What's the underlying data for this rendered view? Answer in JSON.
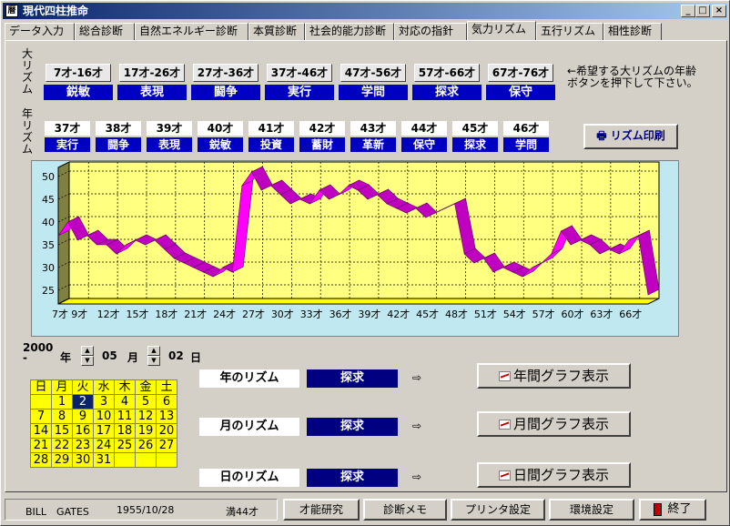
{
  "window": {
    "title": "現代四柱推命",
    "icon": "app-icon",
    "min_glyph": "_",
    "max_glyph": "□",
    "close_glyph": "×"
  },
  "tabs": [
    {
      "label": "データ入力"
    },
    {
      "label": "総合診断"
    },
    {
      "label": "自然エネルギー診断"
    },
    {
      "label": "本質診断"
    },
    {
      "label": "社会的能力診断"
    },
    {
      "label": "対応の指針"
    },
    {
      "label": "気力リズム"
    },
    {
      "label": "五行リズム"
    },
    {
      "label": "相性診断"
    }
  ],
  "active_tab": 6,
  "decade": {
    "side_label": "大リズム",
    "items": [
      {
        "age": "7才-16才",
        "label": "鋭敏"
      },
      {
        "age": "17才-26才",
        "label": "表現"
      },
      {
        "age": "27才-36才",
        "label": "闘争"
      },
      {
        "age": "37才-46才",
        "label": "実行"
      },
      {
        "age": "47才-56才",
        "label": "学問"
      },
      {
        "age": "57才-66才",
        "label": "探求"
      },
      {
        "age": "67才-76才",
        "label": "保守"
      }
    ],
    "note": "←希望する大リズムの年齢ボタンを押下して下さい。"
  },
  "yearly": {
    "side_label": "年リズム",
    "items": [
      {
        "age": "37才",
        "label": "実行"
      },
      {
        "age": "38才",
        "label": "闘争"
      },
      {
        "age": "39才",
        "label": "表現"
      },
      {
        "age": "40才",
        "label": "鋭敏"
      },
      {
        "age": "41才",
        "label": "投資"
      },
      {
        "age": "42才",
        "label": "蓄財"
      },
      {
        "age": "43才",
        "label": "革新"
      },
      {
        "age": "44才",
        "label": "保守"
      },
      {
        "age": "45才",
        "label": "探求"
      },
      {
        "age": "46才",
        "label": "学問"
      }
    ]
  },
  "print_button": {
    "label": "リズム印刷",
    "icon": "printer-icon"
  },
  "chart_data": {
    "type": "area",
    "style": "3d-ribbon",
    "x_tick_labels": [
      "7才",
      "9才",
      "12才",
      "15才",
      "18才",
      "21才",
      "24才",
      "27才",
      "30才",
      "33才",
      "36才",
      "39才",
      "42才",
      "45才",
      "48才",
      "51才",
      "54才",
      "57才",
      "60才",
      "63才",
      "66才"
    ],
    "x": [
      7,
      8,
      9,
      10,
      11,
      12,
      13,
      14,
      15,
      16,
      17,
      18,
      19,
      20,
      21,
      22,
      23,
      24,
      25,
      26,
      27,
      28,
      29,
      30,
      31,
      32,
      33,
      34,
      35,
      36,
      37,
      38,
      39,
      40,
      41,
      42,
      43,
      44,
      45,
      46,
      47,
      48,
      49,
      50,
      51,
      52,
      53,
      54,
      55,
      56,
      57,
      58,
      59,
      60,
      61,
      62,
      63,
      64,
      65,
      66,
      67,
      68
    ],
    "values": [
      37,
      40,
      36,
      37,
      35,
      35,
      33,
      35,
      36,
      35,
      36,
      34,
      32,
      31,
      30,
      29,
      28,
      30,
      29,
      48,
      51,
      47,
      48,
      46,
      44,
      45,
      44,
      47,
      45,
      46,
      48,
      47,
      45,
      46,
      44,
      43,
      42,
      43,
      41,
      42,
      43,
      44,
      33,
      31,
      32,
      29,
      30,
      29,
      28,
      30,
      31,
      33,
      38,
      35,
      36,
      35,
      33,
      34,
      33,
      36,
      37,
      24
    ],
    "ylim": [
      22,
      52
    ],
    "y_ticks": [
      25,
      30,
      35,
      40,
      45,
      50
    ],
    "colors": {
      "ribbon": "#ff00ff",
      "ribbon_side": "#c000c0",
      "plot_bg": "#ffff80",
      "floor": "#ffff00",
      "wall": "#808040",
      "frame_bg": "#c0e8f0"
    },
    "grid": true
  },
  "date": {
    "year": "2000",
    "year_label": "年",
    "month": "05",
    "month_label": "月",
    "day": "02",
    "day_label": "日",
    "dash": "-"
  },
  "calendar": {
    "headers": [
      "日",
      "月",
      "火",
      "水",
      "木",
      "金",
      "土"
    ],
    "weeks": [
      [
        "",
        "1",
        "2",
        "3",
        "4",
        "5",
        "6"
      ],
      [
        "7",
        "8",
        "9",
        "10",
        "11",
        "12",
        "13"
      ],
      [
        "14",
        "15",
        "16",
        "17",
        "18",
        "19",
        "20"
      ],
      [
        "21",
        "22",
        "23",
        "24",
        "25",
        "26",
        "27"
      ],
      [
        "28",
        "29",
        "30",
        "31",
        "",
        "",
        ""
      ]
    ],
    "selected": "2"
  },
  "rhythms": [
    {
      "label": "年のリズム",
      "value": "探求",
      "button": "年間グラフ表示"
    },
    {
      "label": "月のリズム",
      "value": "探求",
      "button": "月間グラフ表示"
    },
    {
      "label": "日のリズム",
      "value": "探求",
      "button": "日間グラフ表示"
    }
  ],
  "status": {
    "name": "BILL　GATES",
    "birth": "1955/10/28",
    "age": "満44才",
    "buttons": [
      "才能研究",
      "診断メモ",
      "プリンタ設定",
      "環境設定"
    ],
    "exit": "終了"
  }
}
